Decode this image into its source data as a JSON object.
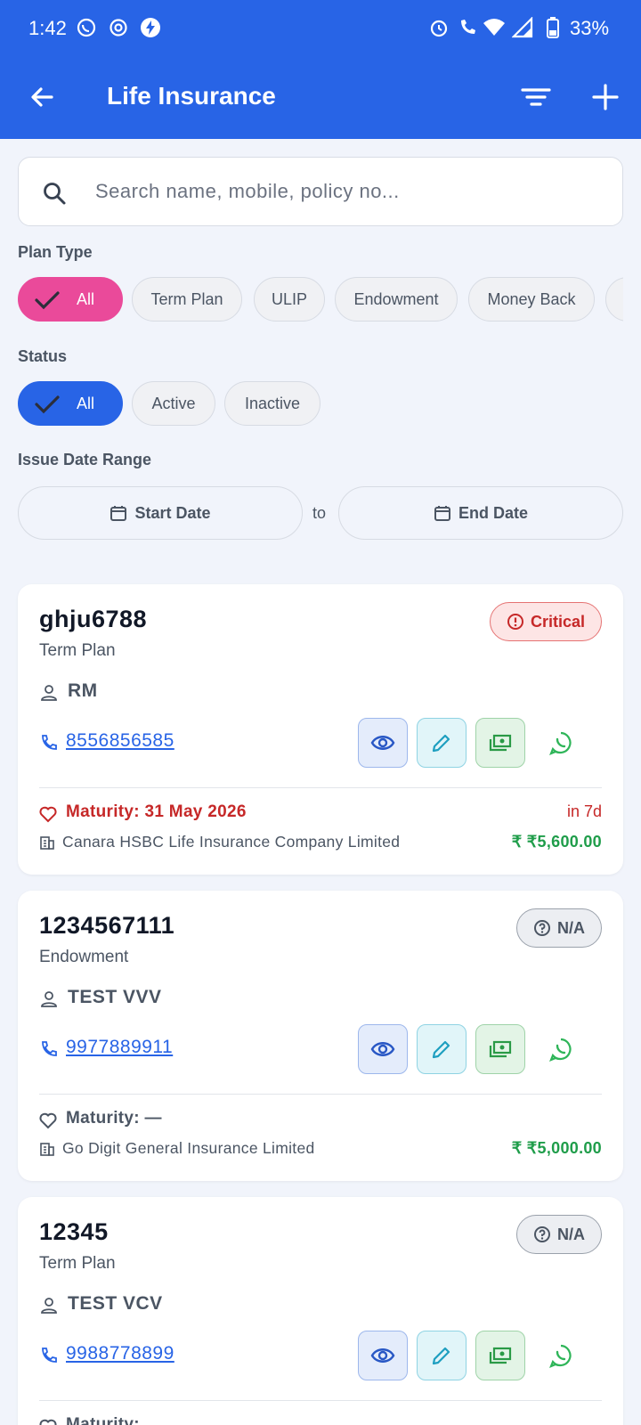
{
  "status_bar": {
    "time": "1:42",
    "battery": "33%"
  },
  "app_bar": {
    "title": "Life Insurance"
  },
  "search": {
    "placeholder": "Search name, mobile, policy no..."
  },
  "filters": {
    "plan_type_label": "Plan Type",
    "plan_types": [
      "All",
      "Term Plan",
      "ULIP",
      "Endowment",
      "Money Back"
    ],
    "plan_type_selected": "All",
    "status_label": "Status",
    "statuses": [
      "All",
      "Active",
      "Inactive"
    ],
    "status_selected": "All",
    "date_range_label": "Issue Date Range",
    "start_date": "Start Date",
    "to": "to",
    "end_date": "End Date"
  },
  "policies": [
    {
      "policy_no": "ghju6788",
      "plan": "Term Plan",
      "badge": "Critical",
      "holder": "RM",
      "phone": "8556856585",
      "maturity": "Maturity: 31 May 2026",
      "due": "in 7d",
      "company": "Canara HSBC Life Insurance Company Limited",
      "amount": "₹ ₹5,600.00"
    },
    {
      "policy_no": "1234567111",
      "plan": "Endowment",
      "badge": "N/A",
      "holder": "TEST VVV",
      "phone": "9977889911",
      "maturity": "Maturity: —",
      "due": "",
      "company": "Go Digit General Insurance Limited",
      "amount": "₹ ₹5,000.00"
    },
    {
      "policy_no": "12345",
      "plan": "Term Plan",
      "badge": "N/A",
      "holder": "TEST VCV",
      "phone": "9988778899",
      "maturity": "Maturity:",
      "due": "",
      "company": "",
      "amount": ""
    }
  ],
  "colors": {
    "primary": "#2864e6",
    "plan_selected": "#ea4a9a",
    "critical": "#c62828",
    "amount": "#1f9d4a"
  }
}
